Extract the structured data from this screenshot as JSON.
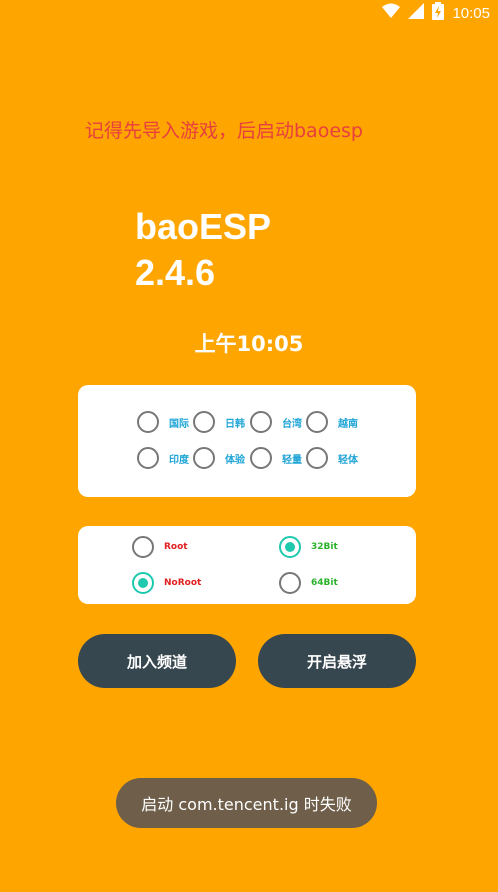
{
  "status_bar": {
    "time": "10:05",
    "icons": [
      "wifi-icon",
      "signal-icon",
      "battery-charging-icon"
    ]
  },
  "hint": "记得先导入游戏，后启动baoesp",
  "app": {
    "name": "baoESP",
    "version": "2.4.6"
  },
  "clock": "上午10:05",
  "region_options": [
    {
      "label": "国际",
      "checked": false
    },
    {
      "label": "日韩",
      "checked": false
    },
    {
      "label": "台湾",
      "checked": false
    },
    {
      "label": "越南",
      "checked": false
    },
    {
      "label": "印度",
      "checked": false
    },
    {
      "label": "体验",
      "checked": false
    },
    {
      "label": "轻量",
      "checked": false
    },
    {
      "label": "轻体",
      "checked": false
    }
  ],
  "mode_options": {
    "root": {
      "label": "Root",
      "checked": false
    },
    "noroot": {
      "label": "NoRoot",
      "checked": true
    },
    "bit32": {
      "label": "32Bit",
      "checked": true
    },
    "bit64": {
      "label": "64Bit",
      "checked": false
    }
  },
  "buttons": {
    "join_channel": "加入频道",
    "open_float": "开启悬浮"
  },
  "toast": "启动 com.tencent.ig 时失败",
  "colors": {
    "background": "#FFA500",
    "hint": "#E83F3F",
    "button": "#37474F",
    "accent": "#1EC9AE"
  }
}
